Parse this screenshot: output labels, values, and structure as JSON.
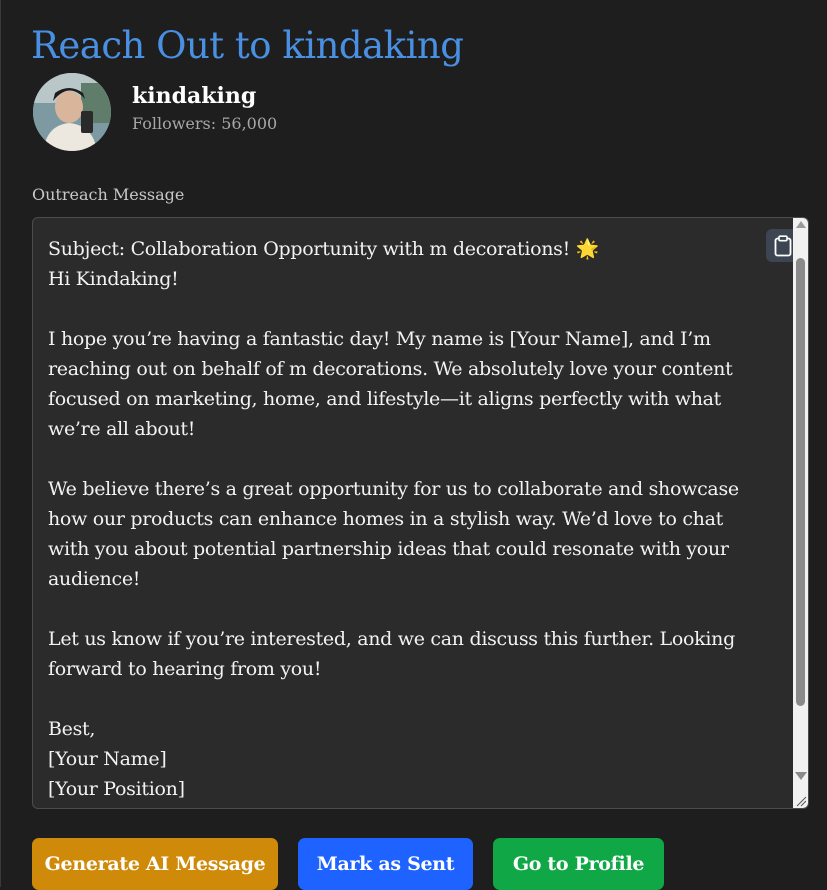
{
  "page": {
    "title": "Reach Out to kindaking"
  },
  "profile": {
    "username": "kindaking",
    "followers": "Followers: 56,000"
  },
  "outreach": {
    "label": "Outreach Message",
    "subject_line": "Subject: Collaboration Opportunity with m decorations! ",
    "subject_emoji": "🌟",
    "body": "\nHi Kindaking!\n\nI hope you’re having a fantastic day! My name is [Your Name], and I’m reaching out on behalf of m decorations. We absolutely love your content focused on marketing, home, and lifestyle—it aligns perfectly with what we’re all about!\n\nWe believe there’s a great opportunity for us to collaborate and showcase how our products can enhance homes in a stylish way. We’d love to chat with you about potential partnership ideas that could resonate with your audience!\n\nLet us know if you’re interested, and we can discuss this further. Looking forward to hearing from you!\n\nBest,\n[Your Name]\n[Your Position]",
    "copy_icon": "clipboard-icon"
  },
  "actions": {
    "generate_label": "Generate AI Message",
    "mark_sent_label": "Mark as Sent",
    "go_profile_label": "Go to Profile"
  },
  "colors": {
    "title": "#4a90e2",
    "generate": "#d08a0a",
    "mark_sent": "#1e63ff",
    "go_profile": "#10a846"
  }
}
